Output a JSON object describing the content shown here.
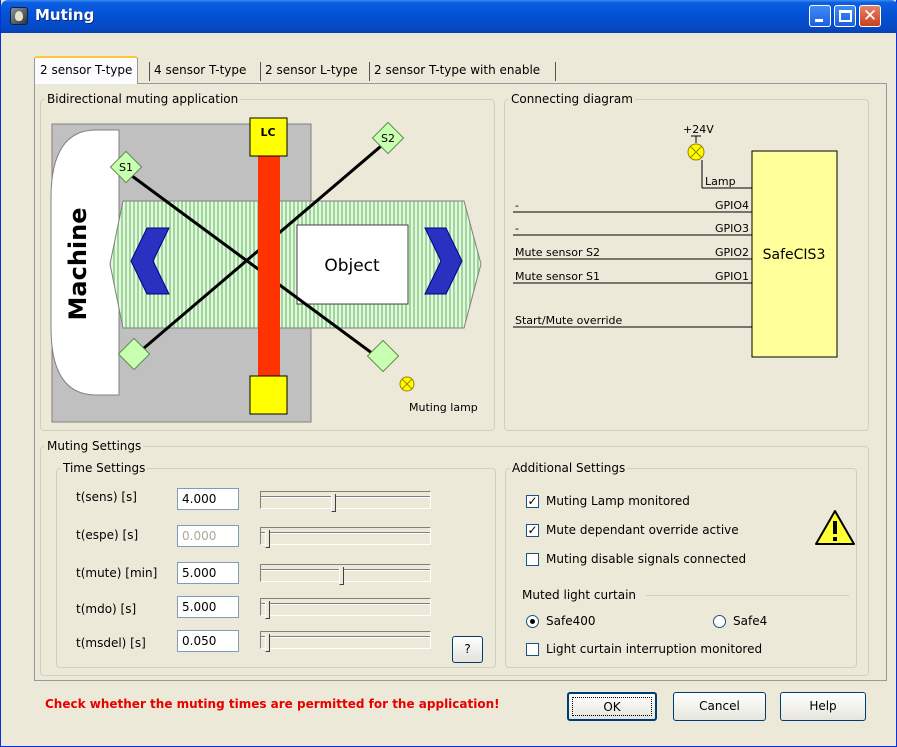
{
  "window": {
    "title": "Muting"
  },
  "tabs": [
    {
      "label": "2 sensor T-type",
      "active": true
    },
    {
      "label": "4 sensor T-type",
      "active": false
    },
    {
      "label": "2 sensor L-type",
      "active": false
    },
    {
      "label": "2 sensor T-type with enable",
      "active": false
    }
  ],
  "application_group": {
    "title": "Bidirectional muting application",
    "machine_label": "Machine",
    "object_label": "Object",
    "lc_label": "LC",
    "s1_label": "S1",
    "s2_label": "S2",
    "lamp_label": "Muting lamp"
  },
  "connecting_group": {
    "title": "Connecting diagram",
    "supply_label": "+24V",
    "device_label": "SafeCIS3",
    "lamp_pin": "Lamp",
    "pins": [
      {
        "signal": "-",
        "pin": "GPIO4"
      },
      {
        "signal": "-",
        "pin": "GPIO3"
      },
      {
        "signal": "Mute sensor S2",
        "pin": "GPIO2"
      },
      {
        "signal": "Mute sensor S1",
        "pin": "GPIO1"
      }
    ],
    "override_label": "Start/Mute override"
  },
  "muting_settings": {
    "title": "Muting Settings",
    "time_settings": {
      "title": "Time Settings",
      "rows": [
        {
          "label": "t(sens) [s]",
          "value": "4.000",
          "enabled": true,
          "slider_fraction": 0.42
        },
        {
          "label": "t(espe) [s]",
          "value": "0.000",
          "enabled": false,
          "slider_fraction": 0.0
        },
        {
          "label": "t(mute) [min]",
          "value": "5.000",
          "enabled": true,
          "slider_fraction": 0.47
        },
        {
          "label": "t(mdo) [s]",
          "value": "5.000",
          "enabled": true,
          "slider_fraction": 0.0
        },
        {
          "label": "t(msdel) [s]",
          "value": "0.050",
          "enabled": true,
          "slider_fraction": 0.0
        }
      ],
      "help_label": "?"
    },
    "additional": {
      "title": "Additional Settings",
      "checks": [
        {
          "label": "Muting Lamp monitored",
          "checked": true
        },
        {
          "label": "Mute dependant override active",
          "checked": true
        },
        {
          "label": "Muting disable signals connected",
          "checked": false
        }
      ],
      "light_curtain_title": "Muted light curtain",
      "radios": [
        {
          "label": "Safe400",
          "selected": true
        },
        {
          "label": "Safe4",
          "selected": false
        }
      ],
      "interruption_check": {
        "label": "Light curtain interruption monitored",
        "checked": false
      },
      "warning_icon": "warning-icon"
    }
  },
  "footer": {
    "warning": "Check whether the muting times are permitted for the application!",
    "ok_label": "OK",
    "cancel_label": "Cancel",
    "help_label": "Help"
  },
  "colors": {
    "titlebar": "#0553d6",
    "light_curtain": "#ff3300",
    "lc_box": "#ffff00",
    "sensor": "#c8ffb0",
    "arrows": "#2a30c0",
    "device": "#ffff99",
    "warning_text": "#e80000"
  }
}
